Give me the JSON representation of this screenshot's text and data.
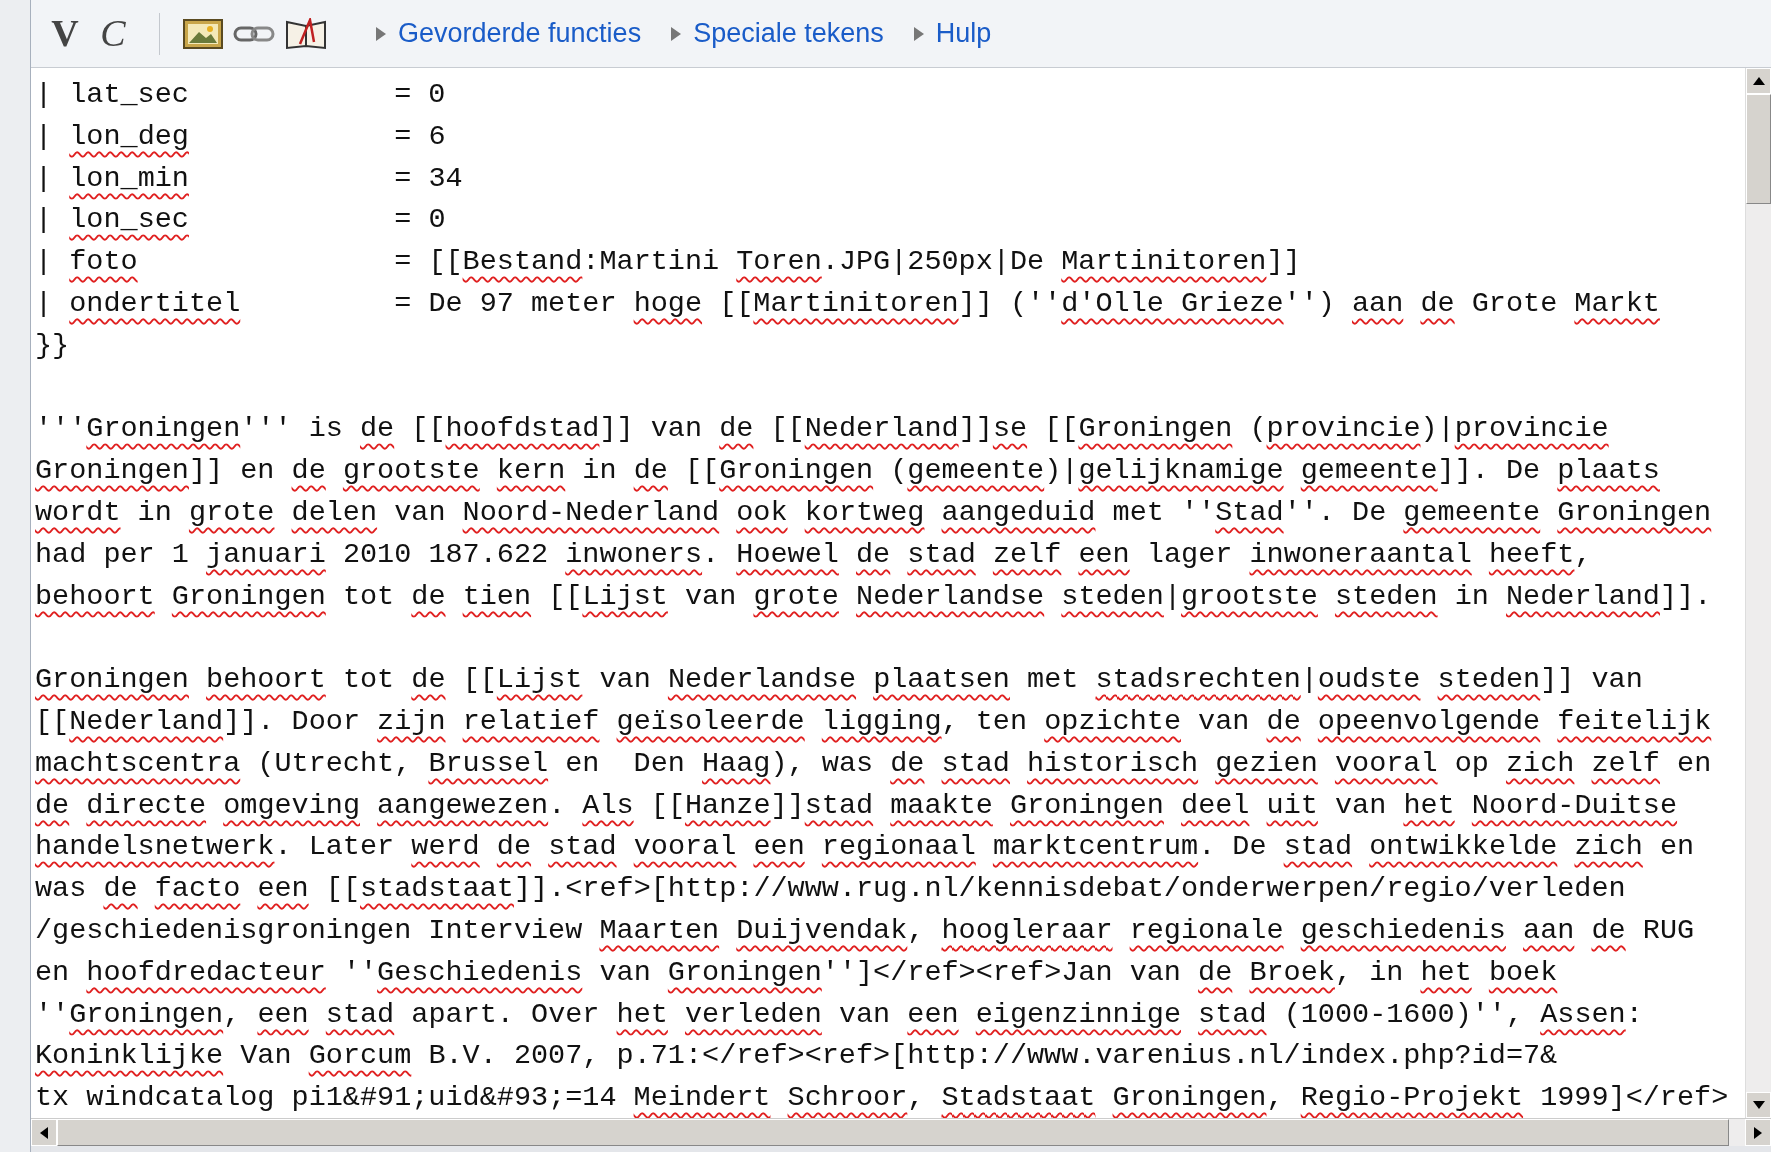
{
  "toolbar": {
    "buttons": [
      {
        "kind": "bold",
        "label": "V"
      },
      {
        "kind": "italic",
        "label": "C"
      },
      {
        "kind": "image"
      },
      {
        "kind": "link"
      },
      {
        "kind": "reference"
      }
    ],
    "links": [
      "Gevorderde functies",
      "Speciale tekens",
      "Hulp"
    ]
  },
  "editor": {
    "lines": [
      {
        "kind": "text",
        "segments": [
          {
            "text": "| lat_sec            = 0",
            "misspelled": false
          }
        ]
      },
      {
        "kind": "text",
        "segments": [
          {
            "text": "| ",
            "misspelled": false
          },
          {
            "text": "lon_deg",
            "misspelled": true
          },
          {
            "text": "            = 6",
            "misspelled": false
          }
        ]
      },
      {
        "kind": "text",
        "segments": [
          {
            "text": "| ",
            "misspelled": false
          },
          {
            "text": "lon_min",
            "misspelled": true
          },
          {
            "text": "            = 34",
            "misspelled": false
          }
        ]
      },
      {
        "kind": "text",
        "segments": [
          {
            "text": "| ",
            "misspelled": false
          },
          {
            "text": "lon_sec",
            "misspelled": true
          },
          {
            "text": "            = 0",
            "misspelled": false
          }
        ]
      },
      {
        "kind": "text",
        "segments": [
          {
            "text": "| ",
            "misspelled": false
          },
          {
            "text": "foto",
            "misspelled": true
          },
          {
            "text": "               = [[",
            "misspelled": false
          },
          {
            "text": "Bestand",
            "misspelled": true
          },
          {
            "text": ":Martini ",
            "misspelled": false
          },
          {
            "text": "Toren",
            "misspelled": true
          },
          {
            "text": ".JPG|250px|De ",
            "misspelled": false
          },
          {
            "text": "Martinitoren",
            "misspelled": true
          },
          {
            "text": "]]",
            "misspelled": false
          }
        ]
      },
      {
        "kind": "text",
        "segments": [
          {
            "text": "| ",
            "misspelled": false
          },
          {
            "text": "ondertitel",
            "misspelled": true
          },
          {
            "text": "         = De 97 meter ",
            "misspelled": false
          },
          {
            "text": "hoge",
            "misspelled": true
          },
          {
            "text": " [[",
            "misspelled": false
          },
          {
            "text": "Martinitoren",
            "misspelled": true
          },
          {
            "text": "]] (''",
            "misspelled": false
          },
          {
            "text": "d'Olle Grieze",
            "misspelled": true
          },
          {
            "text": "'') ",
            "misspelled": false
          },
          {
            "text": "aan ",
            "misspelled": true
          },
          {
            "text": "de",
            "misspelled": true
          },
          {
            "text": " Grote ",
            "misspelled": false
          },
          {
            "text": "Markt",
            "misspelled": true
          }
        ]
      },
      {
        "kind": "text",
        "segments": [
          {
            "text": "}}",
            "misspelled": false
          }
        ]
      },
      {
        "kind": "blank"
      },
      {
        "kind": "text",
        "segments": [
          {
            "text": "'''",
            "misspelled": false
          },
          {
            "text": "Groningen",
            "misspelled": true
          },
          {
            "text": "''' is ",
            "misspelled": false
          },
          {
            "text": "de",
            "misspelled": true
          },
          {
            "text": " [[",
            "misspelled": false
          },
          {
            "text": "hoofdstad",
            "misspelled": true
          },
          {
            "text": "]] van ",
            "misspelled": false
          },
          {
            "text": "de",
            "misspelled": true
          },
          {
            "text": " [[",
            "misspelled": false
          },
          {
            "text": "Nederland",
            "misspelled": true
          },
          {
            "text": "]]",
            "misspelled": false
          },
          {
            "text": "se",
            "misspelled": true
          },
          {
            "text": " [[",
            "misspelled": false
          },
          {
            "text": "Groningen",
            "misspelled": true
          },
          {
            "text": " (",
            "misspelled": false
          },
          {
            "text": "provincie",
            "misspelled": true
          },
          {
            "text": ")|",
            "misspelled": false
          },
          {
            "text": "provincie",
            "misspelled": true
          }
        ]
      },
      {
        "kind": "text",
        "segments": [
          {
            "text": "Groningen",
            "misspelled": true
          },
          {
            "text": "]] en ",
            "misspelled": false
          },
          {
            "text": "de ",
            "misspelled": true
          },
          {
            "text": "grootste ",
            "misspelled": true
          },
          {
            "text": "kern",
            "misspelled": true
          },
          {
            "text": " in ",
            "misspelled": false
          },
          {
            "text": "de",
            "misspelled": true
          },
          {
            "text": " [[",
            "misspelled": false
          },
          {
            "text": "Groningen",
            "misspelled": true
          },
          {
            "text": " (",
            "misspelled": false
          },
          {
            "text": "gemeente",
            "misspelled": true
          },
          {
            "text": ")|",
            "misspelled": false
          },
          {
            "text": "gelijknamige ",
            "misspelled": true
          },
          {
            "text": "gemeente",
            "misspelled": true
          },
          {
            "text": "]]. De ",
            "misspelled": false
          },
          {
            "text": "plaats",
            "misspelled": true
          }
        ]
      },
      {
        "kind": "text",
        "segments": [
          {
            "text": "wordt",
            "misspelled": true
          },
          {
            "text": " in ",
            "misspelled": false
          },
          {
            "text": "grote ",
            "misspelled": true
          },
          {
            "text": "delen",
            "misspelled": true
          },
          {
            "text": " van ",
            "misspelled": false
          },
          {
            "text": "Noord-Nederland ",
            "misspelled": true
          },
          {
            "text": "ook ",
            "misspelled": true
          },
          {
            "text": "kortweg ",
            "misspelled": true
          },
          {
            "text": "aangeduid",
            "misspelled": true
          },
          {
            "text": " met ''",
            "misspelled": false
          },
          {
            "text": "Stad",
            "misspelled": true
          },
          {
            "text": "''. De ",
            "misspelled": false
          },
          {
            "text": "gemeente ",
            "misspelled": true
          },
          {
            "text": "Groningen",
            "misspelled": true
          }
        ]
      },
      {
        "kind": "text",
        "segments": [
          {
            "text": "had per 1 ",
            "misspelled": false
          },
          {
            "text": "januari",
            "misspelled": true
          },
          {
            "text": " 2010 187.622 ",
            "misspelled": false
          },
          {
            "text": "inwoners",
            "misspelled": true
          },
          {
            "text": ". ",
            "misspelled": false
          },
          {
            "text": "Hoewel ",
            "misspelled": true
          },
          {
            "text": "de ",
            "misspelled": true
          },
          {
            "text": "stad ",
            "misspelled": true
          },
          {
            "text": "zelf ",
            "misspelled": true
          },
          {
            "text": "een",
            "misspelled": true
          },
          {
            "text": " lager ",
            "misspelled": false
          },
          {
            "text": "inwoneraantal ",
            "misspelled": true
          },
          {
            "text": "heeft",
            "misspelled": true
          },
          {
            "text": ",",
            "misspelled": false
          }
        ]
      },
      {
        "kind": "text",
        "segments": [
          {
            "text": "behoort ",
            "misspelled": true
          },
          {
            "text": "Groningen",
            "misspelled": true
          },
          {
            "text": " tot ",
            "misspelled": false
          },
          {
            "text": "de ",
            "misspelled": true
          },
          {
            "text": "tien",
            "misspelled": true
          },
          {
            "text": " [[",
            "misspelled": false
          },
          {
            "text": "Lijst",
            "misspelled": true
          },
          {
            "text": " van ",
            "misspelled": false
          },
          {
            "text": "grote ",
            "misspelled": true
          },
          {
            "text": "Nederlandse ",
            "misspelled": true
          },
          {
            "text": "steden",
            "misspelled": true
          },
          {
            "text": "|",
            "misspelled": false
          },
          {
            "text": "grootste ",
            "misspelled": true
          },
          {
            "text": "steden",
            "misspelled": true
          },
          {
            "text": " in ",
            "misspelled": false
          },
          {
            "text": "Nederland",
            "misspelled": true
          },
          {
            "text": "]].",
            "misspelled": false
          }
        ]
      },
      {
        "kind": "blank"
      },
      {
        "kind": "text",
        "segments": [
          {
            "text": "Groningen ",
            "misspelled": true
          },
          {
            "text": "behoort",
            "misspelled": true
          },
          {
            "text": " tot ",
            "misspelled": false
          },
          {
            "text": "de",
            "misspelled": true
          },
          {
            "text": " [[",
            "misspelled": false
          },
          {
            "text": "Lijst",
            "misspelled": true
          },
          {
            "text": " van ",
            "misspelled": false
          },
          {
            "text": "Nederlandse ",
            "misspelled": true
          },
          {
            "text": "plaatsen",
            "misspelled": true
          },
          {
            "text": " met ",
            "misspelled": false
          },
          {
            "text": "stadsrechten",
            "misspelled": true
          },
          {
            "text": "|",
            "misspelled": false
          },
          {
            "text": "oudste ",
            "misspelled": true
          },
          {
            "text": "steden",
            "misspelled": true
          },
          {
            "text": "]] van",
            "misspelled": false
          }
        ]
      },
      {
        "kind": "text",
        "segments": [
          {
            "text": "[[",
            "misspelled": false
          },
          {
            "text": "Nederland",
            "misspelled": true
          },
          {
            "text": "]]. Door ",
            "misspelled": false
          },
          {
            "text": "zijn ",
            "misspelled": true
          },
          {
            "text": "relatief ",
            "misspelled": true
          },
          {
            "text": "geïsoleerde ",
            "misspelled": true
          },
          {
            "text": "ligging",
            "misspelled": true
          },
          {
            "text": ", ten ",
            "misspelled": false
          },
          {
            "text": "opzichte",
            "misspelled": true
          },
          {
            "text": " van ",
            "misspelled": false
          },
          {
            "text": "de ",
            "misspelled": true
          },
          {
            "text": "opeenvolgende ",
            "misspelled": true
          },
          {
            "text": "feitelijk",
            "misspelled": true
          }
        ]
      },
      {
        "kind": "text",
        "segments": [
          {
            "text": "machtscentra",
            "misspelled": true
          },
          {
            "text": " (Utrecht, ",
            "misspelled": false
          },
          {
            "text": "Brussel",
            "misspelled": true
          },
          {
            "text": " en  Den ",
            "misspelled": false
          },
          {
            "text": "Haag",
            "misspelled": true
          },
          {
            "text": "), was ",
            "misspelled": false
          },
          {
            "text": "de ",
            "misspelled": true
          },
          {
            "text": "stad ",
            "misspelled": true
          },
          {
            "text": "historisch ",
            "misspelled": true
          },
          {
            "text": "gezien ",
            "misspelled": true
          },
          {
            "text": "vooral",
            "misspelled": true
          },
          {
            "text": " op ",
            "misspelled": false
          },
          {
            "text": "zich ",
            "misspelled": true
          },
          {
            "text": "zelf",
            "misspelled": true
          },
          {
            "text": " en",
            "misspelled": false
          }
        ]
      },
      {
        "kind": "text",
        "segments": [
          {
            "text": "de ",
            "misspelled": true
          },
          {
            "text": "directe ",
            "misspelled": true
          },
          {
            "text": "omgeving ",
            "misspelled": true
          },
          {
            "text": "aangewezen",
            "misspelled": true
          },
          {
            "text": ". ",
            "misspelled": false
          },
          {
            "text": "Als",
            "misspelled": true
          },
          {
            "text": " [[",
            "misspelled": false
          },
          {
            "text": "Hanze",
            "misspelled": true
          },
          {
            "text": "]]",
            "misspelled": false
          },
          {
            "text": "stad ",
            "misspelled": true
          },
          {
            "text": "maakte ",
            "misspelled": true
          },
          {
            "text": "Groningen ",
            "misspelled": true
          },
          {
            "text": "deel ",
            "misspelled": true
          },
          {
            "text": "uit",
            "misspelled": true
          },
          {
            "text": " van ",
            "misspelled": false
          },
          {
            "text": "het ",
            "misspelled": true
          },
          {
            "text": "Noord-Duitse",
            "misspelled": true
          }
        ]
      },
      {
        "kind": "text",
        "segments": [
          {
            "text": "handelsnetwerk",
            "misspelled": true
          },
          {
            "text": ". Later ",
            "misspelled": false
          },
          {
            "text": "werd ",
            "misspelled": true
          },
          {
            "text": "de ",
            "misspelled": true
          },
          {
            "text": "stad ",
            "misspelled": true
          },
          {
            "text": "vooral ",
            "misspelled": true
          },
          {
            "text": "een ",
            "misspelled": true
          },
          {
            "text": "regionaal ",
            "misspelled": true
          },
          {
            "text": "marktcentrum",
            "misspelled": true
          },
          {
            "text": ". De ",
            "misspelled": false
          },
          {
            "text": "stad ",
            "misspelled": true
          },
          {
            "text": "ontwikkelde ",
            "misspelled": true
          },
          {
            "text": "zich",
            "misspelled": true
          },
          {
            "text": " en",
            "misspelled": false
          }
        ]
      },
      {
        "kind": "text",
        "segments": [
          {
            "text": "was ",
            "misspelled": false
          },
          {
            "text": "de ",
            "misspelled": true
          },
          {
            "text": "facto ",
            "misspelled": true
          },
          {
            "text": "een",
            "misspelled": true
          },
          {
            "text": " [[",
            "misspelled": false
          },
          {
            "text": "stadstaat",
            "misspelled": true
          },
          {
            "text": "]].<ref>[http://www.rug.nl/kennisdebat/onderwerpen/regio/verleden",
            "misspelled": false
          }
        ]
      },
      {
        "kind": "text",
        "segments": [
          {
            "text": "/geschiedenisgroningen Interview ",
            "misspelled": false
          },
          {
            "text": "Maarten ",
            "misspelled": true
          },
          {
            "text": "Duijvendak",
            "misspelled": true
          },
          {
            "text": ", ",
            "misspelled": false
          },
          {
            "text": "hoogleraar ",
            "misspelled": true
          },
          {
            "text": "regionale ",
            "misspelled": true
          },
          {
            "text": "geschiedenis ",
            "misspelled": true
          },
          {
            "text": "aan ",
            "misspelled": true
          },
          {
            "text": "de",
            "misspelled": true
          },
          {
            "text": " RUG",
            "misspelled": false
          }
        ]
      },
      {
        "kind": "text",
        "segments": [
          {
            "text": "en ",
            "misspelled": false
          },
          {
            "text": "hoofdredacteur",
            "misspelled": true
          },
          {
            "text": " ''",
            "misspelled": false
          },
          {
            "text": "Geschiedenis",
            "misspelled": true
          },
          {
            "text": " van ",
            "misspelled": false
          },
          {
            "text": "Groningen",
            "misspelled": true
          },
          {
            "text": "'']</ref><ref>Jan van ",
            "misspelled": false
          },
          {
            "text": "de ",
            "misspelled": true
          },
          {
            "text": "Broek",
            "misspelled": true
          },
          {
            "text": ", in ",
            "misspelled": false
          },
          {
            "text": "het ",
            "misspelled": true
          },
          {
            "text": "boek",
            "misspelled": true
          }
        ]
      },
      {
        "kind": "text",
        "segments": [
          {
            "text": "''",
            "misspelled": false
          },
          {
            "text": "Groningen",
            "misspelled": true
          },
          {
            "text": ", ",
            "misspelled": false
          },
          {
            "text": "een ",
            "misspelled": true
          },
          {
            "text": "stad",
            "misspelled": true
          },
          {
            "text": " apart. Over ",
            "misspelled": false
          },
          {
            "text": "het ",
            "misspelled": true
          },
          {
            "text": "verleden",
            "misspelled": true
          },
          {
            "text": " van ",
            "misspelled": false
          },
          {
            "text": "een ",
            "misspelled": true
          },
          {
            "text": "eigenzinnige ",
            "misspelled": true
          },
          {
            "text": "stad",
            "misspelled": true
          },
          {
            "text": " (1000-1600)'', ",
            "misspelled": false
          },
          {
            "text": "Assen",
            "misspelled": true
          },
          {
            "text": ":",
            "misspelled": false
          }
        ]
      },
      {
        "kind": "text",
        "segments": [
          {
            "text": "Koninklijke",
            "misspelled": true
          },
          {
            "text": " Van ",
            "misspelled": false
          },
          {
            "text": "Gorcum",
            "misspelled": true
          },
          {
            "text": " B.V. 2007, p.71:</ref><ref>[http://www.varenius.nl/index.php?id=7&",
            "misspelled": false
          }
        ]
      },
      {
        "kind": "text",
        "segments": [
          {
            "text": "tx windcatalog pi1&#91;uid&#93;=14 ",
            "misspelled": false
          },
          {
            "text": "Meindert ",
            "misspelled": true
          },
          {
            "text": "Schroor",
            "misspelled": true
          },
          {
            "text": ", ",
            "misspelled": false
          },
          {
            "text": "Stadstaat ",
            "misspelled": true
          },
          {
            "text": "Groningen",
            "misspelled": true
          },
          {
            "text": ", ",
            "misspelled": false
          },
          {
            "text": "Regio-Projekt",
            "misspelled": true
          },
          {
            "text": " 1999]</ref>",
            "misspelled": false
          }
        ]
      }
    ]
  }
}
